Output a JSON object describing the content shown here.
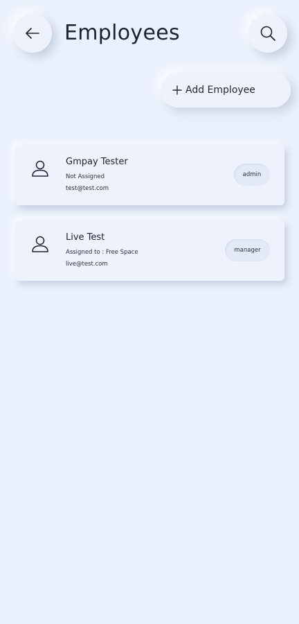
{
  "header": {
    "title": "Employees",
    "back_icon": "arrow-left-icon",
    "search_icon": "search-icon"
  },
  "actions": {
    "add_label": "Add Employee"
  },
  "employees": [
    {
      "name": "Gmpay Tester",
      "assignment": "Not Assigned",
      "email": "test@test.com",
      "role": "admin"
    },
    {
      "name": "Live Test",
      "assignment": "Assigned to : Free Space",
      "email": "live@test.com",
      "role": "manager"
    }
  ],
  "colors": {
    "background": "#ebf1fc",
    "text": "#1c2130",
    "badge": "#e3e9f5"
  }
}
